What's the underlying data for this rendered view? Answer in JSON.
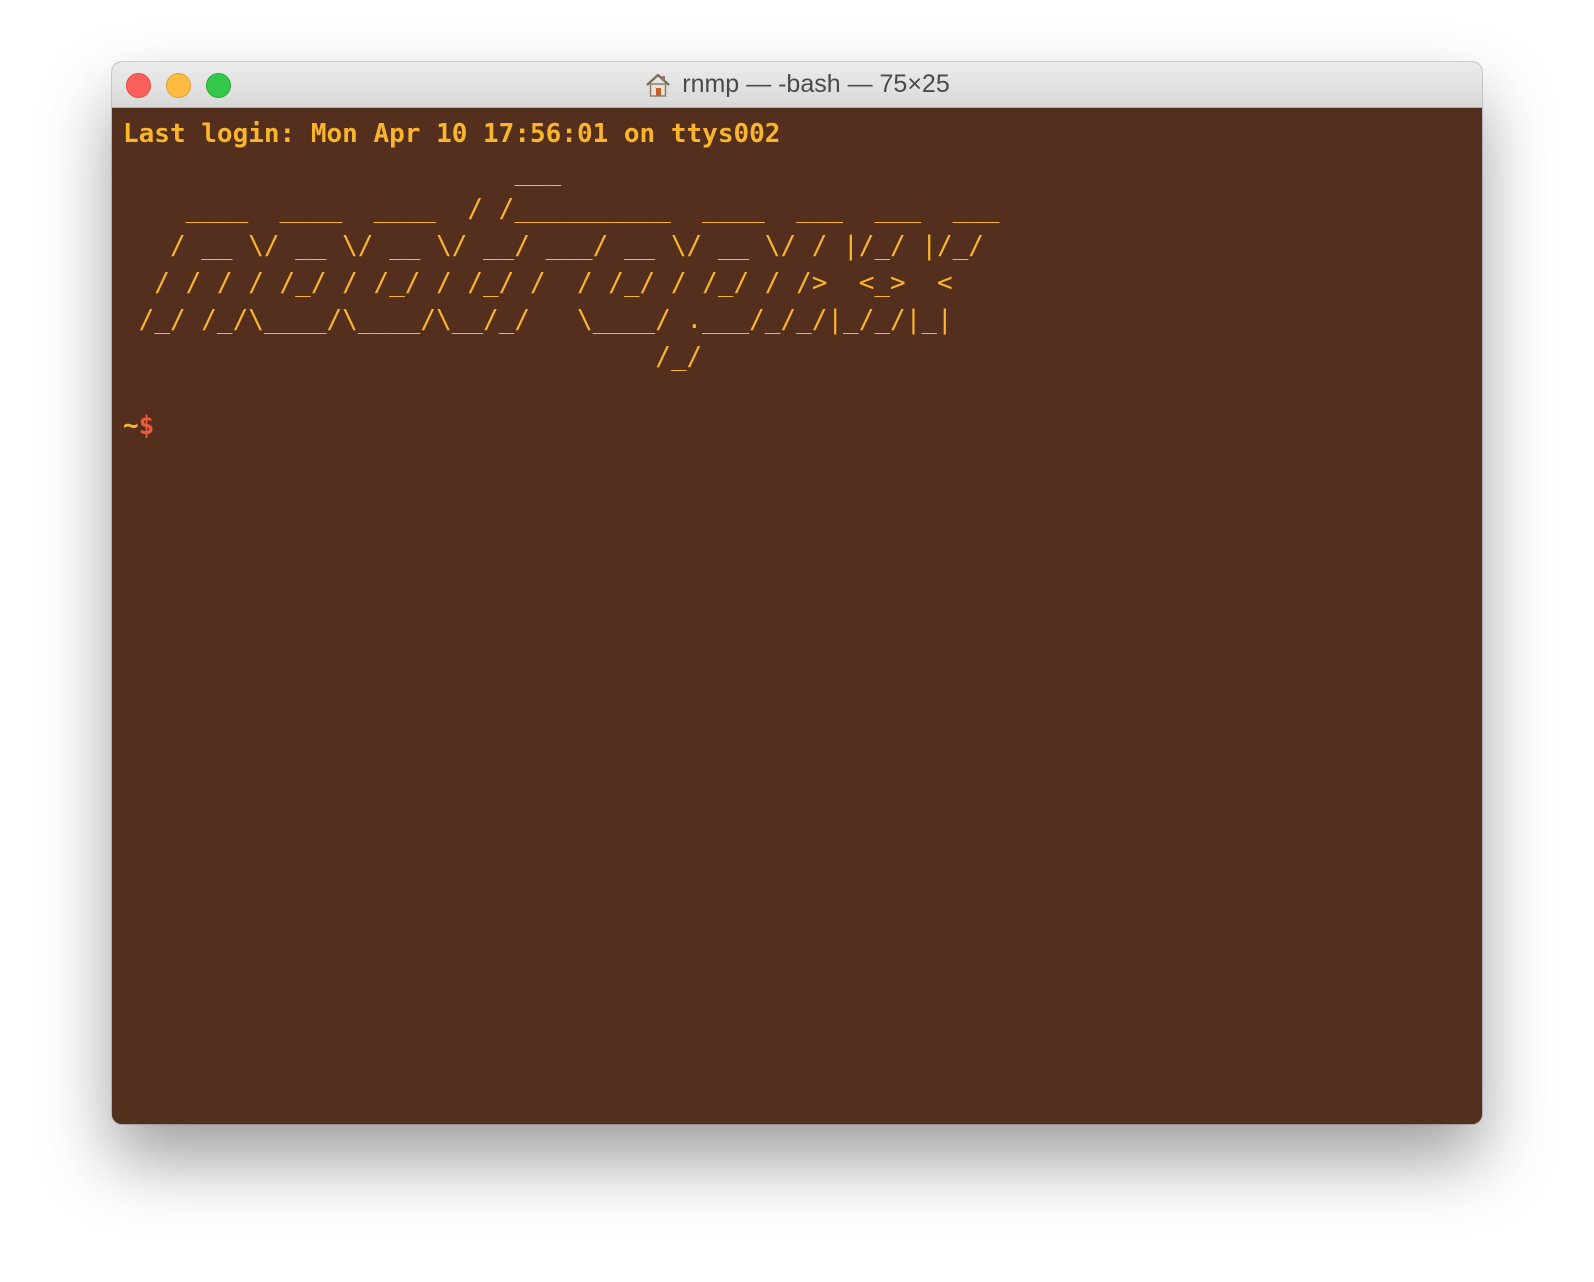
{
  "window": {
    "title": "rnmp — -bash — 75×25",
    "title_icon": "home-icon",
    "traffic_lights": {
      "close_color": "#fc605c",
      "minimize_color": "#fdbc40",
      "zoom_color": "#34c84a"
    }
  },
  "terminal": {
    "background_color": "#552f1e",
    "text_color": "#f9b52c",
    "prompt_symbol_color": "#ea5a3c",
    "last_login": "Last login: Mon Apr 10 17:56:01 on ttys002",
    "banner_lines": [
      "                         ___",
      "    ____  ____  ____  / /__________  ____  ___  ___  ___",
      "   / __ \\/ __ \\/ __ \\/ __/ ___/ __ \\/ __ \\/ / |/_/ |/_/",
      "  / / / / /_/ / /_/ / /_/ /  / /_/ / /_/ / />  <_>  <",
      " /_/ /_/\\____/\\____/\\__/_/   \\____/ .___/_/_/|_/_/|_|",
      "                                  /_/"
    ],
    "prompt": {
      "path": "~",
      "symbol": "$"
    }
  }
}
